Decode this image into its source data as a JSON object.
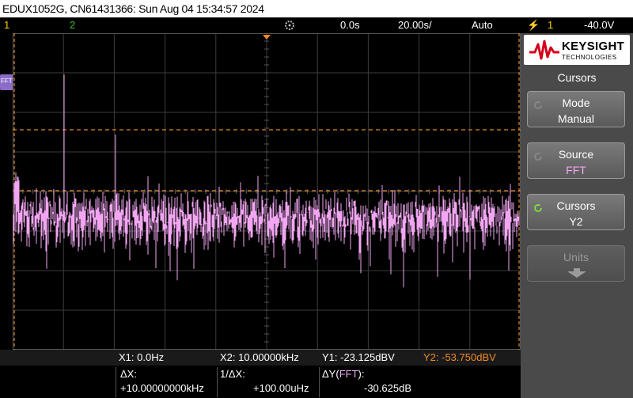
{
  "title": "EDUX1052G, CN61431366: Sun Aug 04 15:34:57 2024",
  "status": {
    "ch1": "1",
    "ch2": "2",
    "trig_delay": "0.0s",
    "timebase": "20.00s/",
    "mode": "Auto",
    "trig_icon": "⚡",
    "trig_ch": "1",
    "trig_level": "-40.0V"
  },
  "side": {
    "brand": "KEYSIGHT",
    "brand_sub": "TECHNOLOGIES",
    "menu_title": "Cursors",
    "keys": [
      {
        "l1": "Mode",
        "l2": "Manual"
      },
      {
        "l1": "Source",
        "l2": "FFT"
      },
      {
        "l1": "Cursors",
        "l2": "Y2"
      },
      {
        "l1": "Units",
        "l2": ""
      }
    ]
  },
  "marker": "FFT",
  "readout": {
    "x1": "X1:  0.0Hz",
    "x2": "X2:  10.00000kHz",
    "y1": "Y1: -23.125dBV",
    "y2": "Y2: -53.750dBV",
    "dx_label": "ΔX:",
    "dx": "+10.00000000kHz",
    "inv_dx_label": "1/ΔX:",
    "inv_dx": "+100.00uHz",
    "dy_label": "ΔY(",
    "dy_src": "FFT",
    "dy_label_end": "):",
    "dy": "-30.625dB"
  },
  "colors": {
    "trace": "#f2a6f2",
    "cursor": "#d98a2a",
    "ch1": "#f5d000",
    "ch2": "#36c236",
    "grid": "#3c3c3c",
    "cursor_y2": "#f08a2a"
  }
}
